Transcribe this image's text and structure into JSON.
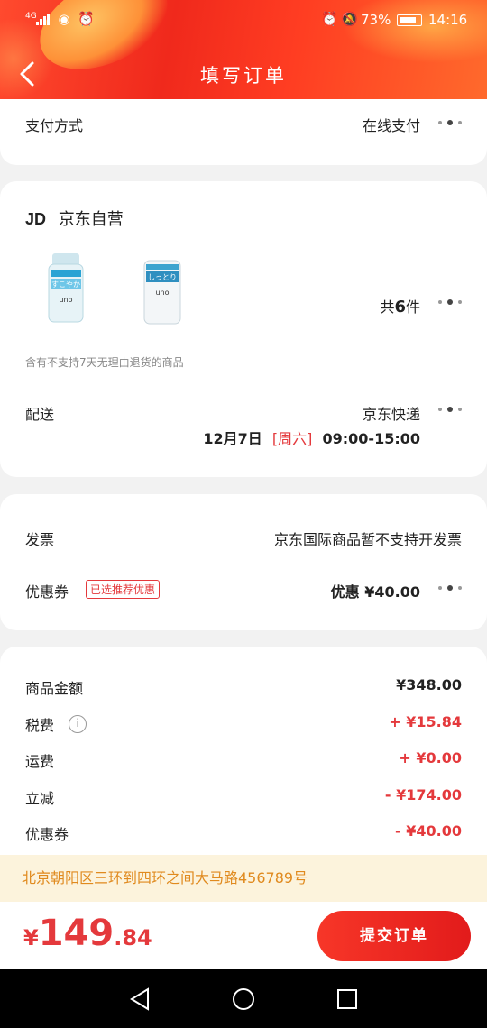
{
  "status_bar": {
    "network": "4G",
    "battery_pct": "73%",
    "time": "14:16"
  },
  "header": {
    "title": "填写订单"
  },
  "payment": {
    "label": "支付方式",
    "value": "在线支付"
  },
  "shop": {
    "logo": "JD",
    "name": "京东自营",
    "count_prefix": "共",
    "count": "6",
    "count_suffix": "件",
    "return_notice": "含有不支持7天无理由退货的商品",
    "product_labels": [
      "すこやか",
      "しっとり"
    ],
    "brand": "uno",
    "delivery": {
      "label": "配送",
      "carrier": "京东快递",
      "date": "12月7日",
      "weekday": "[周六]",
      "time": "09:00-15:00"
    }
  },
  "invoice": {
    "label": "发票",
    "value": "京东国际商品暂不支持开发票",
    "coupon_label": "优惠券",
    "coupon_badge": "已选推荐优惠",
    "coupon_value": "优惠 ¥40.00"
  },
  "summary": [
    {
      "label": "商品金额",
      "value": "¥348.00",
      "style": "black"
    },
    {
      "label": "税费",
      "value": "+ ¥15.84",
      "style": "red",
      "info_icon": true
    },
    {
      "label": "运费",
      "value": "+ ¥0.00",
      "style": "red"
    },
    {
      "label": "立减",
      "value": "- ¥174.00",
      "style": "red"
    },
    {
      "label": "优惠券",
      "value": "- ¥40.00",
      "style": "red"
    }
  ],
  "address_notice": "北京朝阳区三环到四环之间大马路456789号",
  "footer": {
    "currency": "¥",
    "total_int": "149",
    "total_dec": ".84",
    "submit_label": "提交订单"
  },
  "colors": {
    "accent_red": "#e4393c",
    "header_red": "#f0291c",
    "notice_bg": "#fcf3dc",
    "notice_text": "#e08a1e"
  }
}
